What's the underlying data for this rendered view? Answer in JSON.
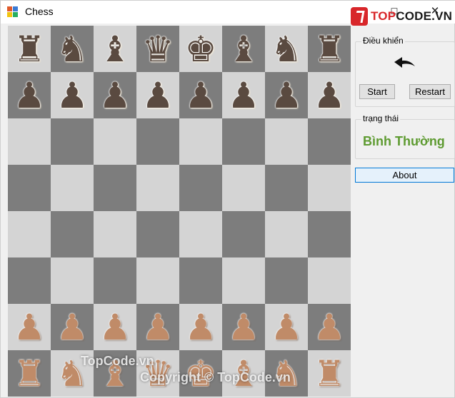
{
  "window": {
    "title": "Chess",
    "controls": {
      "minimize": "–",
      "maximize": "☐",
      "close": "✕"
    }
  },
  "watermark": {
    "logo_prefix": "TOP",
    "logo_suffix": "CODE.VN",
    "overlay_1": "TopCode.vn",
    "overlay_2": "Copyright © TopCode.vn"
  },
  "board": {
    "ranks": [
      [
        {
          "p": "♜",
          "c": "black"
        },
        {
          "p": "♞",
          "c": "black"
        },
        {
          "p": "♝",
          "c": "black"
        },
        {
          "p": "♛",
          "c": "black"
        },
        {
          "p": "♚",
          "c": "black"
        },
        {
          "p": "♝",
          "c": "black"
        },
        {
          "p": "♞",
          "c": "black"
        },
        {
          "p": "♜",
          "c": "black"
        }
      ],
      [
        {
          "p": "♟",
          "c": "black"
        },
        {
          "p": "♟",
          "c": "black"
        },
        {
          "p": "♟",
          "c": "black"
        },
        {
          "p": "♟",
          "c": "black"
        },
        {
          "p": "♟",
          "c": "black"
        },
        {
          "p": "♟",
          "c": "black"
        },
        {
          "p": "♟",
          "c": "black"
        },
        {
          "p": "♟",
          "c": "black"
        }
      ],
      [
        {},
        {},
        {},
        {},
        {},
        {},
        {},
        {}
      ],
      [
        {},
        {},
        {},
        {},
        {},
        {},
        {},
        {}
      ],
      [
        {},
        {},
        {},
        {},
        {},
        {},
        {},
        {}
      ],
      [
        {},
        {},
        {},
        {},
        {},
        {},
        {},
        {}
      ],
      [
        {
          "p": "♟",
          "c": "white"
        },
        {
          "p": "♟",
          "c": "white"
        },
        {
          "p": "♟",
          "c": "white"
        },
        {
          "p": "♟",
          "c": "white"
        },
        {
          "p": "♟",
          "c": "white"
        },
        {
          "p": "♟",
          "c": "white"
        },
        {
          "p": "♟",
          "c": "white"
        },
        {
          "p": "♟",
          "c": "white"
        }
      ],
      [
        {
          "p": "♜",
          "c": "white"
        },
        {
          "p": "♞",
          "c": "white"
        },
        {
          "p": "♝",
          "c": "white"
        },
        {
          "p": "♛",
          "c": "white"
        },
        {
          "p": "♚",
          "c": "white"
        },
        {
          "p": "♝",
          "c": "white"
        },
        {
          "p": "♞",
          "c": "white"
        },
        {
          "p": "♜",
          "c": "white"
        }
      ]
    ]
  },
  "controls_panel": {
    "legend": "Điều khiển",
    "undo_icon": "undo-arrow-icon",
    "start_label": "Start",
    "restart_label": "Restart"
  },
  "status_panel": {
    "legend": "trạng thái",
    "status": "Bình Thường"
  },
  "about_label": "About",
  "colors": {
    "light_square": "#d4d4d4",
    "dark_square": "#7d7d7d",
    "status_green": "#5e9b31",
    "logo_red": "#d8262a",
    "about_border": "#0078d7"
  }
}
